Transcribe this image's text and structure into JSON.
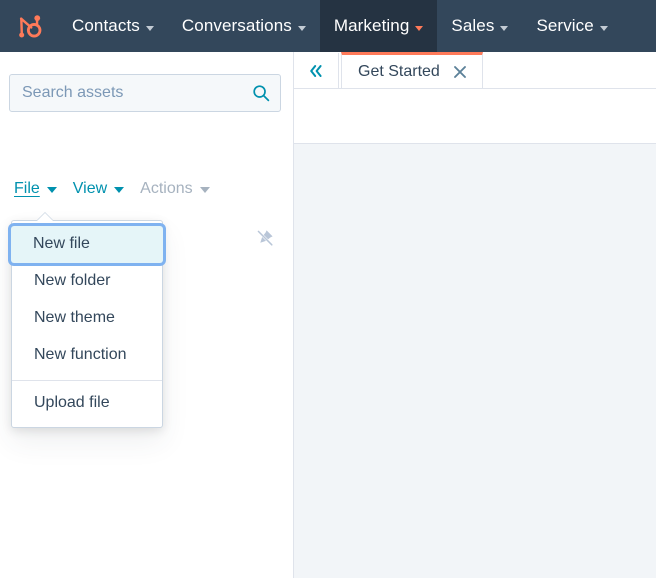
{
  "colors": {
    "navbar_bg": "#33475b",
    "navbar_active_bg": "#253342",
    "brand_orange": "#ff7a59",
    "teal": "#0091ae",
    "text_dark": "#33475b",
    "muted": "#a6b2bf",
    "border": "#dfe3eb",
    "focus_ring": "#7fb2f0",
    "focus_fill": "#e5f5f8",
    "content_bg": "#f2f5f8",
    "search_bg": "#f5f8fa"
  },
  "navbar": {
    "logo_icon": "hubspot-sprocket-logo",
    "items": [
      {
        "label": "Contacts",
        "active": false,
        "caret_icon": "chevron-down-icon"
      },
      {
        "label": "Conversations",
        "active": false,
        "caret_icon": "chevron-down-icon"
      },
      {
        "label": "Marketing",
        "active": true,
        "caret_icon": "chevron-down-icon"
      },
      {
        "label": "Sales",
        "active": false,
        "caret_icon": "chevron-down-icon"
      },
      {
        "label": "Service",
        "active": false,
        "caret_icon": "chevron-down-icon"
      }
    ]
  },
  "sidebar": {
    "search": {
      "placeholder": "Search assets",
      "value": "",
      "icon": "search-icon"
    },
    "menubar": [
      {
        "label": "File",
        "state": "active",
        "caret_icon": "caret-down-icon"
      },
      {
        "label": "View",
        "state": "enabled",
        "caret_icon": "caret-down-icon"
      },
      {
        "label": "Actions",
        "state": "disabled",
        "caret_icon": "caret-down-icon"
      }
    ],
    "pin_icon": "unpin-icon"
  },
  "file_menu": {
    "open": true,
    "groups": [
      {
        "items": [
          {
            "label": "New file",
            "focused": true
          },
          {
            "label": "New folder",
            "focused": false
          },
          {
            "label": "New theme",
            "focused": false
          },
          {
            "label": "New function",
            "focused": false
          }
        ]
      },
      {
        "items": [
          {
            "label": "Upload file",
            "focused": false
          }
        ]
      }
    ]
  },
  "right_pane": {
    "collapse_button": {
      "icon": "double-chevron-left-icon"
    },
    "tabs": [
      {
        "label": "Get Started",
        "active": true,
        "close_icon": "close-icon"
      }
    ]
  }
}
